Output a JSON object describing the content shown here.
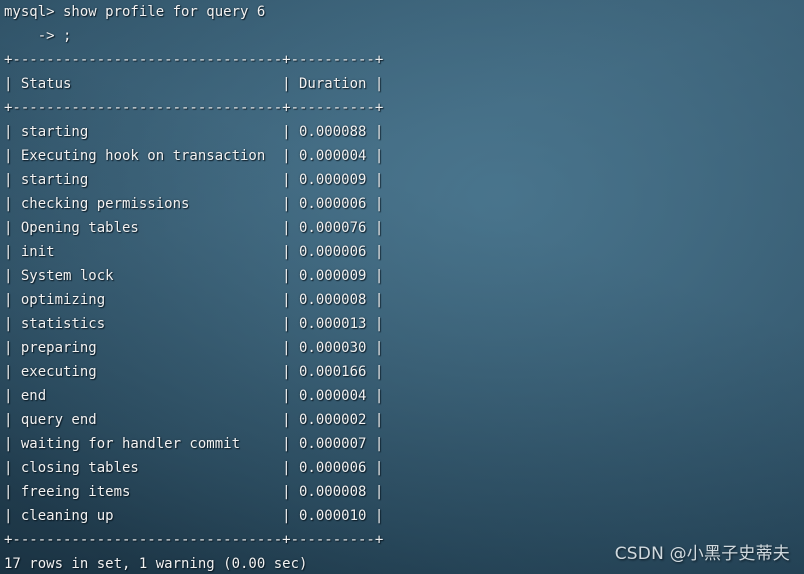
{
  "terminal": {
    "prompt_line": "mysql> show profile for query 6",
    "continuation_line": "    -> ;",
    "separator": "+--------------------------------+----------+",
    "header": {
      "status_label": "Status",
      "duration_label": "Duration"
    },
    "columns": {
      "status_width": 32,
      "duration_width": 10
    },
    "rows": [
      {
        "status": "starting",
        "duration": "0.000088"
      },
      {
        "status": "Executing hook on transaction",
        "duration": "0.000004"
      },
      {
        "status": "starting",
        "duration": "0.000009"
      },
      {
        "status": "checking permissions",
        "duration": "0.000006"
      },
      {
        "status": "Opening tables",
        "duration": "0.000076"
      },
      {
        "status": "init",
        "duration": "0.000006"
      },
      {
        "status": "System lock",
        "duration": "0.000009"
      },
      {
        "status": "optimizing",
        "duration": "0.000008"
      },
      {
        "status": "statistics",
        "duration": "0.000013"
      },
      {
        "status": "preparing",
        "duration": "0.000030"
      },
      {
        "status": "executing",
        "duration": "0.000166"
      },
      {
        "status": "end",
        "duration": "0.000004"
      },
      {
        "status": "query end",
        "duration": "0.000002"
      },
      {
        "status": "waiting for handler commit",
        "duration": "0.000007"
      },
      {
        "status": "closing tables",
        "duration": "0.000006"
      },
      {
        "status": "freeing items",
        "duration": "0.000008"
      },
      {
        "status": "cleaning up",
        "duration": "0.000010"
      }
    ],
    "result_summary": "17 rows in set, 1 warning (0.00 sec)"
  },
  "watermark": {
    "text": "CSDN @小黑子史蒂夫"
  },
  "colors": {
    "background": "#3a5f75",
    "text": "#f2f2f2",
    "watermark": "#dfe6ea"
  }
}
